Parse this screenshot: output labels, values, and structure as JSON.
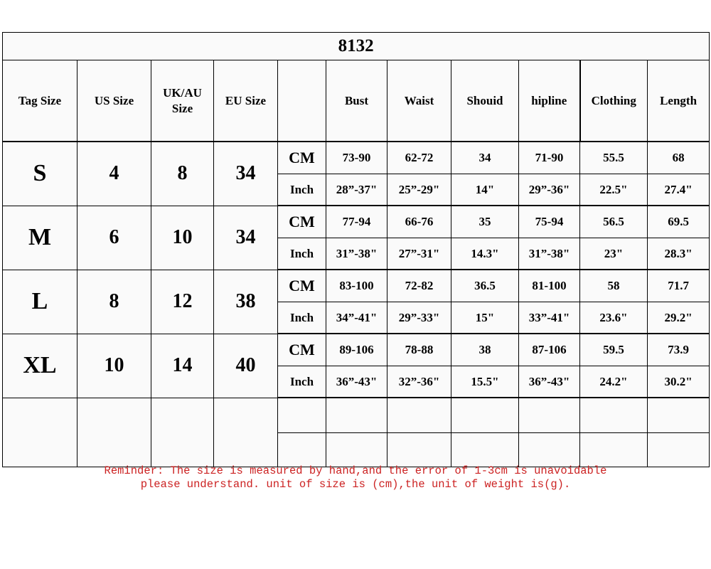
{
  "title": "8132",
  "headers": {
    "tag_size": "Tag Size",
    "us_size": "US Size",
    "uk_au_size": "UK/AU Size",
    "eu_size": "EU Size",
    "unit": "",
    "bust": "Bust",
    "waist": "Waist",
    "shoulder": "Shouid",
    "hipline": "hipline",
    "clothing": "Clothing",
    "length": "Length"
  },
  "units": {
    "cm": "CM",
    "inch": "Inch"
  },
  "rows": [
    {
      "tag_size": "S",
      "us_size": "4",
      "uk_au_size": "8",
      "eu_size": "34",
      "cm": {
        "bust": "73-90",
        "waist": "62-72",
        "shoulder": "34",
        "hipline": "71-90",
        "clothing": "55.5",
        "length": "68"
      },
      "inch": {
        "bust": "28”-37\"",
        "waist": "25”-29\"",
        "shoulder": "14\"",
        "hipline": "29”-36\"",
        "clothing": "22.5\"",
        "length": "27.4\""
      }
    },
    {
      "tag_size": "M",
      "us_size": "6",
      "uk_au_size": "10",
      "eu_size": "34",
      "cm": {
        "bust": "77-94",
        "waist": "66-76",
        "shoulder": "35",
        "hipline": "75-94",
        "clothing": "56.5",
        "length": "69.5"
      },
      "inch": {
        "bust": "31”-38\"",
        "waist": "27”-31\"",
        "shoulder": "14.3\"",
        "hipline": "31”-38\"",
        "clothing": "23\"",
        "length": "28.3\""
      }
    },
    {
      "tag_size": "L",
      "us_size": "8",
      "uk_au_size": "12",
      "eu_size": "38",
      "cm": {
        "bust": "83-100",
        "waist": "72-82",
        "shoulder": "36.5",
        "hipline": "81-100",
        "clothing": "58",
        "length": "71.7"
      },
      "inch": {
        "bust": "34”-41\"",
        "waist": "29”-33\"",
        "shoulder": "15\"",
        "hipline": "33”-41\"",
        "clothing": "23.6\"",
        "length": "29.2\""
      }
    },
    {
      "tag_size": "XL",
      "us_size": "10",
      "uk_au_size": "14",
      "eu_size": "40",
      "cm": {
        "bust": "89-106",
        "waist": "78-88",
        "shoulder": "38",
        "hipline": "87-106",
        "clothing": "59.5",
        "length": "73.9"
      },
      "inch": {
        "bust": "36”-43\"",
        "waist": "32”-36\"",
        "shoulder": "15.5\"",
        "hipline": "36”-43\"",
        "clothing": "24.2\"",
        "length": "30.2\""
      }
    },
    {
      "tag_size": "",
      "us_size": "",
      "uk_au_size": "",
      "eu_size": "",
      "cm": {
        "bust": "",
        "waist": "",
        "shoulder": "",
        "hipline": "",
        "clothing": "",
        "length": ""
      },
      "inch": {
        "bust": "",
        "waist": "",
        "shoulder": "",
        "hipline": "",
        "clothing": "",
        "length": ""
      }
    }
  ],
  "reminder": {
    "line1": "Reminder: The size is measured by hand,and the error of 1-3cm is unavoidable",
    "line2": "please understand. unit of size is (cm),the unit of weight is(g)."
  },
  "colors": {
    "reminder_text": "#cc2222",
    "border": "#000000",
    "cell_background": "#fafafa"
  }
}
